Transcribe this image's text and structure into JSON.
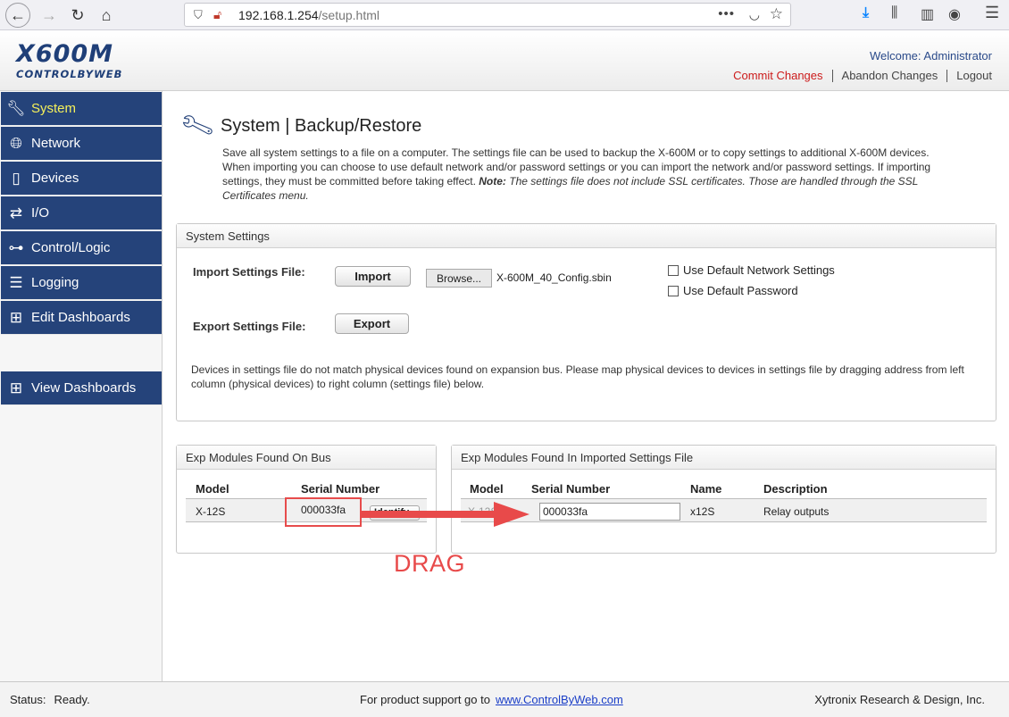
{
  "browser": {
    "url_host": "192.168.1.254",
    "url_path": "/setup.html",
    "dots": "•••"
  },
  "header": {
    "logo_main": "X600M",
    "logo_sub": "CONTROLBYWEB",
    "welcome": "Welcome: Administrator",
    "links": {
      "commit": "Commit Changes",
      "abandon": "Abandon Changes",
      "logout": "Logout"
    }
  },
  "sidebar": {
    "items": [
      {
        "label": "System",
        "icon": "wrench-icon"
      },
      {
        "label": "Network",
        "icon": "globe-icon"
      },
      {
        "label": "Devices",
        "icon": "device-icon"
      },
      {
        "label": "I/O",
        "icon": "io-arrows-icon"
      },
      {
        "label": "Control/Logic",
        "icon": "logic-icon"
      },
      {
        "label": "Logging",
        "icon": "log-icon"
      },
      {
        "label": "Edit Dashboards",
        "icon": "dashboard-icon"
      },
      {
        "label": "View Dashboards",
        "icon": "dashboard-icon"
      }
    ]
  },
  "page": {
    "title": "System | Backup/Restore",
    "desc_main": "Save all system settings to a file on a computer. The settings file can be used to backup the X-600M or to copy settings to additional X-600M devices. When importing you can choose to use default network and/or password settings or you can import the network and/or password settings. If importing settings, they must be committed before taking effect. ",
    "desc_note_label": "Note:",
    "desc_note": " The settings file does not include SSL certificates. Those are handled through the SSL Certificates menu."
  },
  "system_settings": {
    "header": "System Settings",
    "import_label": "Import Settings File:",
    "import_button": "Import",
    "browse_button": "Browse...",
    "file_name": "X-600M_40_Config.sbin",
    "export_label": "Export Settings File:",
    "export_button": "Export",
    "cb_network": "Use Default Network Settings",
    "cb_password": "Use Default Password",
    "mismatch_note": "Devices in settings file do not match physical devices found on expansion bus. Please map physical devices to devices in settings file by dragging address from left column (physical devices) to right column (settings file) below."
  },
  "bus_panel": {
    "header": "Exp Modules Found On Bus",
    "col_model": "Model",
    "col_serial": "Serial Number",
    "row": {
      "model": "X-12S",
      "serial": "000033fa",
      "identify": "Identify"
    }
  },
  "file_panel": {
    "header": "Exp Modules Found In Imported Settings File",
    "col_model": "Model",
    "col_serial": "Serial Number",
    "col_name": "Name",
    "col_desc": "Description",
    "row": {
      "model": "X-12S",
      "serial": "000033fa",
      "name": "x12S",
      "description": "Relay outputs"
    }
  },
  "annotation": {
    "drag": "DRAG",
    "color": "#e84a4a"
  },
  "status": {
    "label": "Status:",
    "value": "Ready.",
    "support_text": "For product support go to",
    "support_link": "www.ControlByWeb.com",
    "company": "Xytronix Research & Design, Inc."
  }
}
